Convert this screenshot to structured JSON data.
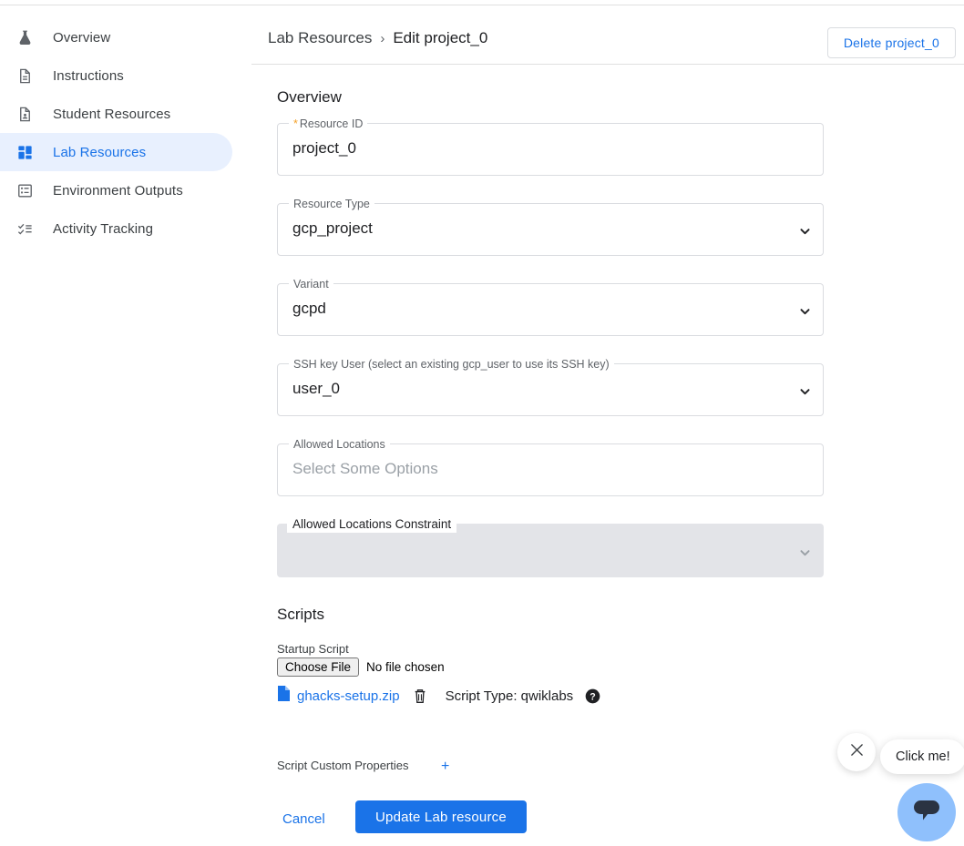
{
  "sidebar": {
    "items": [
      {
        "label": "Overview",
        "icon": "flask-icon",
        "active": false
      },
      {
        "label": "Instructions",
        "icon": "document-icon",
        "active": false
      },
      {
        "label": "Student Resources",
        "icon": "document-person-icon",
        "active": false
      },
      {
        "label": "Lab Resources",
        "icon": "dashboard-grid-icon",
        "active": true
      },
      {
        "label": "Environment Outputs",
        "icon": "list-box-icon",
        "active": false
      },
      {
        "label": "Activity Tracking",
        "icon": "checklist-icon",
        "active": false
      }
    ]
  },
  "header": {
    "breadcrumb_root": "Lab Resources",
    "breadcrumb_separator": "›",
    "breadcrumb_current": "Edit project_0",
    "delete_label": "Delete project_0"
  },
  "main": {
    "overview_heading": "Overview",
    "scripts_heading": "Scripts",
    "fields": {
      "resource_id": {
        "label": "Resource ID",
        "required_marker": "*",
        "value": "project_0"
      },
      "resource_type": {
        "label": "Resource Type",
        "value": "gcp_project"
      },
      "variant": {
        "label": "Variant",
        "value": "gcpd"
      },
      "ssh_key_user": {
        "label": "SSH key User (select an existing gcp_user to use its SSH key)",
        "value": "user_0"
      },
      "allowed_locations": {
        "label": "Allowed Locations",
        "placeholder": "Select Some Options",
        "value": ""
      },
      "allowed_locations_constraint": {
        "label": "Allowed Locations Constraint",
        "value": ""
      }
    },
    "scripts": {
      "startup_script_label": "Startup Script",
      "choose_file_label": "Choose File",
      "no_file_text": "No file chosen",
      "attached_file": "ghacks-setup.zip",
      "script_type_text": "Script Type: qwiklabs",
      "custom_properties_label": "Script Custom Properties",
      "add_property_label": "+"
    },
    "actions": {
      "cancel_label": "Cancel",
      "update_label": "Update Lab resource"
    }
  },
  "chat": {
    "tooltip_label": "Click me!",
    "close_icon": "close-icon",
    "launcher_icon": "chat-bubble-icon"
  },
  "colors": {
    "accent_blue": "#1a73e8",
    "active_nav_bg": "#e8f0fe",
    "required_orange": "#f4a127",
    "filled_field_bg": "#e3e4e8",
    "chat_launcher_bg": "#8fc0fc",
    "chat_glyph": "#2a3342"
  }
}
